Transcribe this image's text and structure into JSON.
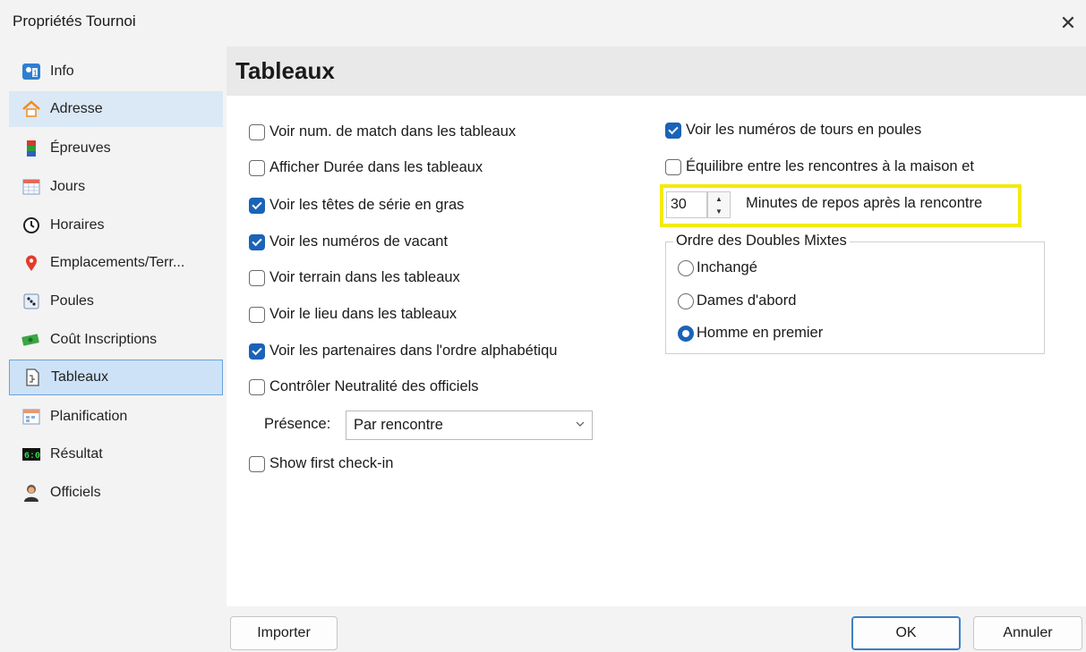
{
  "window": {
    "title": "Propriétés Tournoi",
    "close_glyph": "✕"
  },
  "sidebar": {
    "items": [
      {
        "label": "Info",
        "icon": "info-icon"
      },
      {
        "label": "Adresse",
        "icon": "home-icon"
      },
      {
        "label": "Épreuves",
        "icon": "events-icon"
      },
      {
        "label": "Jours",
        "icon": "calendar-icon"
      },
      {
        "label": "Horaires",
        "icon": "clock-icon"
      },
      {
        "label": "Emplacements/Terr...",
        "icon": "location-pin-icon"
      },
      {
        "label": "Poules",
        "icon": "dice-icon"
      },
      {
        "label": "Coût Inscriptions",
        "icon": "money-icon"
      },
      {
        "label": "Tableaux",
        "icon": "document-icon"
      },
      {
        "label": "Planification",
        "icon": "schedule-icon"
      },
      {
        "label": "Résultat",
        "icon": "scoreboard-icon"
      },
      {
        "label": "Officiels",
        "icon": "official-icon"
      }
    ],
    "hover_index": 1,
    "selected_index": 8
  },
  "panel": {
    "title": "Tableaux"
  },
  "left_options": [
    {
      "label": "Voir num. de match dans les tableaux",
      "checked": false
    },
    {
      "label": "Afficher Durée dans les tableaux",
      "checked": false
    },
    {
      "label": "Voir les têtes de série en gras",
      "checked": true
    },
    {
      "label": "Voir les numéros de vacant",
      "checked": true
    },
    {
      "label": "Voir terrain dans les tableaux",
      "checked": false
    },
    {
      "label": "Voir le lieu dans les tableaux",
      "checked": false
    },
    {
      "label": "Voir les partenaires dans l'ordre alphabétiqu",
      "checked": true
    },
    {
      "label": "Contrôler Neutralité des officiels",
      "checked": false
    }
  ],
  "presence": {
    "label": "Présence:",
    "value": "Par rencontre"
  },
  "show_first_checkin": {
    "label": "Show first check-in",
    "checked": false
  },
  "right_options": [
    {
      "label": "Voir les numéros de tours en poules",
      "checked": true
    },
    {
      "label": "Équilibre entre les rencontres à la maison et",
      "checked": false
    }
  ],
  "rest_minutes": {
    "value": "30",
    "label": "Minutes de repos après la rencontre",
    "highlight_color": "#f2ea0f"
  },
  "mixed_doubles": {
    "group_label": "Ordre des Doubles Mixtes",
    "options": [
      {
        "label": "Inchangé",
        "checked": false
      },
      {
        "label": "Dames d'abord",
        "checked": false
      },
      {
        "label": "Homme en premier",
        "checked": true
      }
    ]
  },
  "buttons": {
    "import": "Importer",
    "ok": "OK",
    "cancel": "Annuler"
  },
  "colors": {
    "accent": "#1b63b7",
    "selection_bg": "#cde2f7",
    "selection_border": "#6aa3db"
  }
}
